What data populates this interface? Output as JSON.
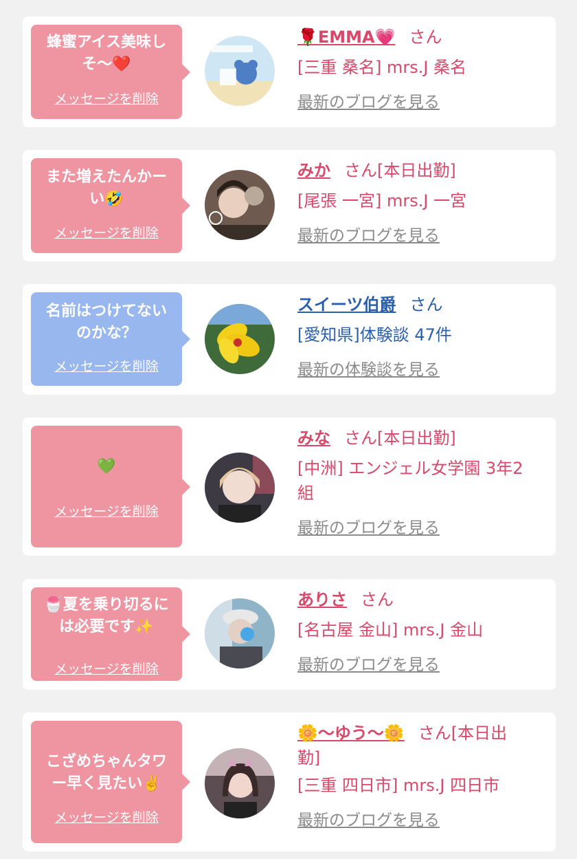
{
  "cards": [
    {
      "message": "蜂蜜アイス美味しそ〜❤️",
      "delete_label": "メッセージを削除",
      "name_prefix_icon": "🌹",
      "name": "EMMA",
      "name_suffix_icon": "💗",
      "honorific": "さん",
      "location": "[三重 桑名] mrs.J 桑名",
      "link": "最新のブログを見る"
    },
    {
      "message": "また増えたんかーい🤣",
      "delete_label": "メッセージを削除",
      "name": "みか",
      "honorific": "さん[本日出勤]",
      "location": "[尾張 一宮] mrs.J 一宮",
      "link": "最新のブログを見る"
    },
    {
      "message": "名前はつけてないのかな？",
      "delete_label": "メッセージを削除",
      "name": "スイーツ伯爵",
      "honorific": "さん",
      "location": "[愛知県]体験談 47件",
      "link": "最新の体験談を見る"
    },
    {
      "message": "💚",
      "delete_label": "メッセージを削除",
      "name": "みな",
      "honorific": "さん[本日出勤]",
      "location_line1": "[中洲] エンジェル女学園 3年2",
      "location_line2": "組",
      "link": "最新のブログを見る"
    },
    {
      "message_line1": "🍧夏を乗り切るに",
      "message_line2": "は必要です✨",
      "delete_label": "メッセージを削除",
      "name": "ありさ",
      "honorific": "さん",
      "location": "[名古屋 金山] mrs.J 金山",
      "link": "最新のブログを見る"
    },
    {
      "message_line1": "こざめちゃんタワ",
      "message_line2": "ー早く見たい✌️",
      "delete_label": "メッセージを削除",
      "name": "🌼〜ゆう〜🌼",
      "honorific": "さん[本日出",
      "honorific_line2": "勤]",
      "location": "[三重 四日市] mrs.J 四日市",
      "link": "最新のブログを見る"
    }
  ]
}
